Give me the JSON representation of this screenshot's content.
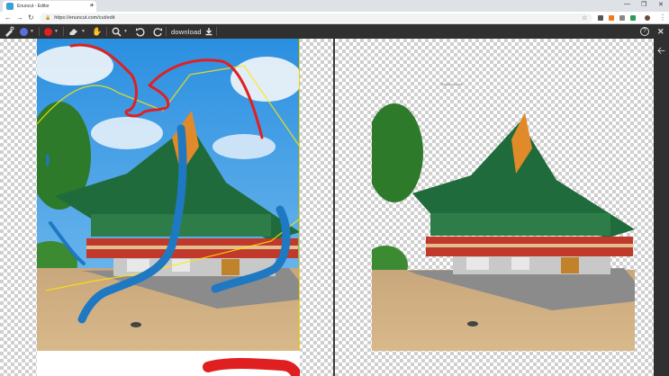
{
  "browser": {
    "tab_title": "Enuncut - Editor",
    "tab_close": "×",
    "new_tab": "+",
    "url": "https://enuncut.com/cut/edit",
    "secure_icon": "lock-icon",
    "nav_back": "←",
    "nav_forward": "→",
    "nav_reload": "↻",
    "star": "☆",
    "win_min": "—",
    "win_max": "❐",
    "win_close": "✕"
  },
  "toolbar": {
    "download_label": "download",
    "help": "?",
    "close": "✕"
  },
  "sidebar": {
    "back_arrow": "🡠"
  },
  "colors": {
    "brush_keep": "#1f78c2",
    "brush_remove": "#e02020",
    "selection_outline": "#ffe700"
  },
  "preview": {
    "watermark": "Enuncut.com"
  }
}
